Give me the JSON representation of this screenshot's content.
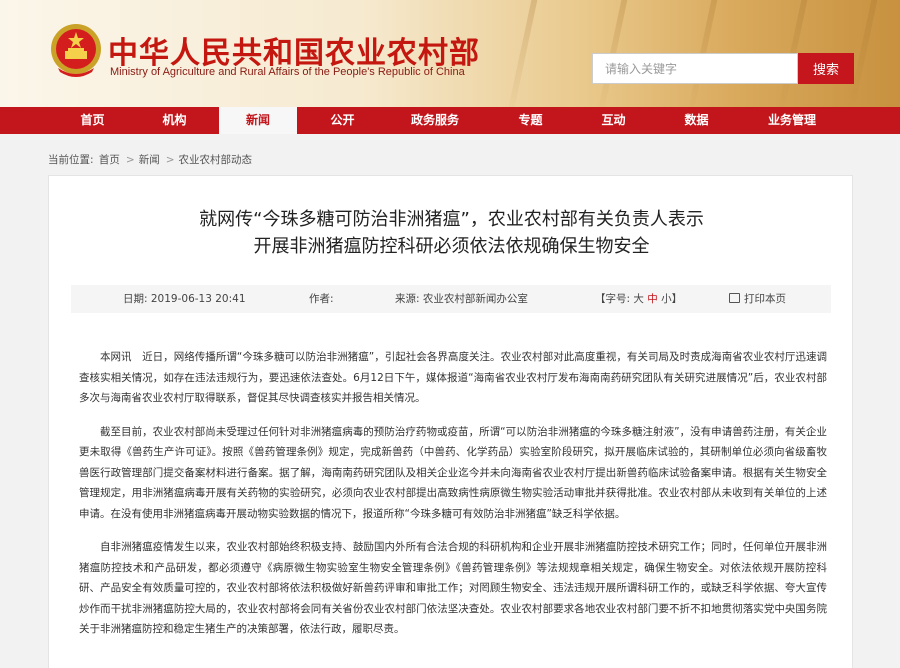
{
  "header": {
    "title": "中华人民共和国农业农村部",
    "subtitle": "Ministry of Agriculture and Rural Affairs of the People's Republic of China",
    "emblem_icon": "national-emblem-icon"
  },
  "search": {
    "placeholder": "请输入关键字",
    "button_label": "搜索"
  },
  "nav": {
    "items": [
      {
        "label": "首页"
      },
      {
        "label": "机构"
      },
      {
        "label": "新闻"
      },
      {
        "label": "公开"
      },
      {
        "label": "政务服务"
      },
      {
        "label": "专题"
      },
      {
        "label": "互动"
      },
      {
        "label": "数据"
      },
      {
        "label": "业务管理"
      }
    ],
    "active": "新闻"
  },
  "breadcrumb": {
    "prefix": "当前位置:",
    "items": [
      "首页",
      "新闻",
      "农业农村部动态"
    ],
    "separator": ">"
  },
  "article": {
    "title_line1": "就网传“今珠多糖可防治非洲猪瘟”，农业农村部有关负责人表示",
    "title_line2": "开展非洲猪瘟防控科研必须依法依规确保生物安全",
    "meta": {
      "date": "日期: 2019-06-13 20:41",
      "author": "作者:",
      "source": "来源: 农业农村部新闻办公室",
      "font_size_label": "【字号:",
      "font_big": "大",
      "font_mid": "中",
      "font_small": "小】",
      "print_label": "打印本页"
    },
    "paragraphs": [
      "本网讯　近日，网络传播所谓“今珠多糖可以防治非洲猪瘟”，引起社会各界高度关注。农业农村部对此高度重视，有关司局及时责成海南省农业农村厅迅速调查核实相关情况，如存在违法违规行为，要迅速依法查处。6月12日下午，媒体报道“海南省农业农村厅发布海南南药研究团队有关研究进展情况”后，农业农村部多次与海南省农业农村厅取得联系，督促其尽快调查核实并报告相关情况。",
      "截至目前，农业农村部尚未受理过任何针对非洲猪瘟病毒的预防治疗药物或疫苗，所谓“可以防治非洲猪瘟的今珠多糖注射液”，没有申请兽药注册，有关企业更未取得《兽药生产许可证》。按照《兽药管理条例》规定，完成新兽药（中兽药、化学药品）实验室阶段研究，拟开展临床试验的，其研制单位必须向省级畜牧兽医行政管理部门提交备案材料进行备案。据了解，海南南药研究团队及相关企业迄今并未向海南省农业农村厅提出新兽药临床试验备案申请。根据有关生物安全管理规定，用非洲猪瘟病毒开展有关药物的实验研究，必须向农业农村部提出高致病性病原微生物实验活动审批并获得批准。农业农村部从未收到有关单位的上述申请。在没有使用非洲猪瘟病毒开展动物实验数据的情况下，报道所称“今珠多糖可有效防治非洲猪瘟”缺乏科学依据。",
      "自非洲猪瘟疫情发生以来，农业农村部始终积极支持、鼓励国内外所有合法合规的科研机构和企业开展非洲猪瘟防控技术研究工作；同时，任何单位开展非洲猪瘟防控技术和产品研发，都必须遵守《病原微生物实验室生物安全管理条例》《兽药管理条例》等法规规章相关规定，确保生物安全。对依法依规开展防控科研、产品安全有效质量可控的，农业农村部将依法积极做好新兽药评审和审批工作；对罔顾生物安全、违法违规开展所谓科研工作的，或缺乏科学依据、夸大宣传炒作而干扰非洲猪瘟防控大局的，农业农村部将会同有关省份农业农村部门依法坚决查处。农业农村部要求各地农业农村部门要不折不扣地贯彻落实党中央国务院关于非洲猪瘟防控和稳定生猪生产的决策部署，依法行政，履职尽责。"
    ]
  },
  "colors": {
    "brand_red": "#c3161c",
    "title_red": "#c3170f",
    "page_bg": "#f2f2f2"
  }
}
